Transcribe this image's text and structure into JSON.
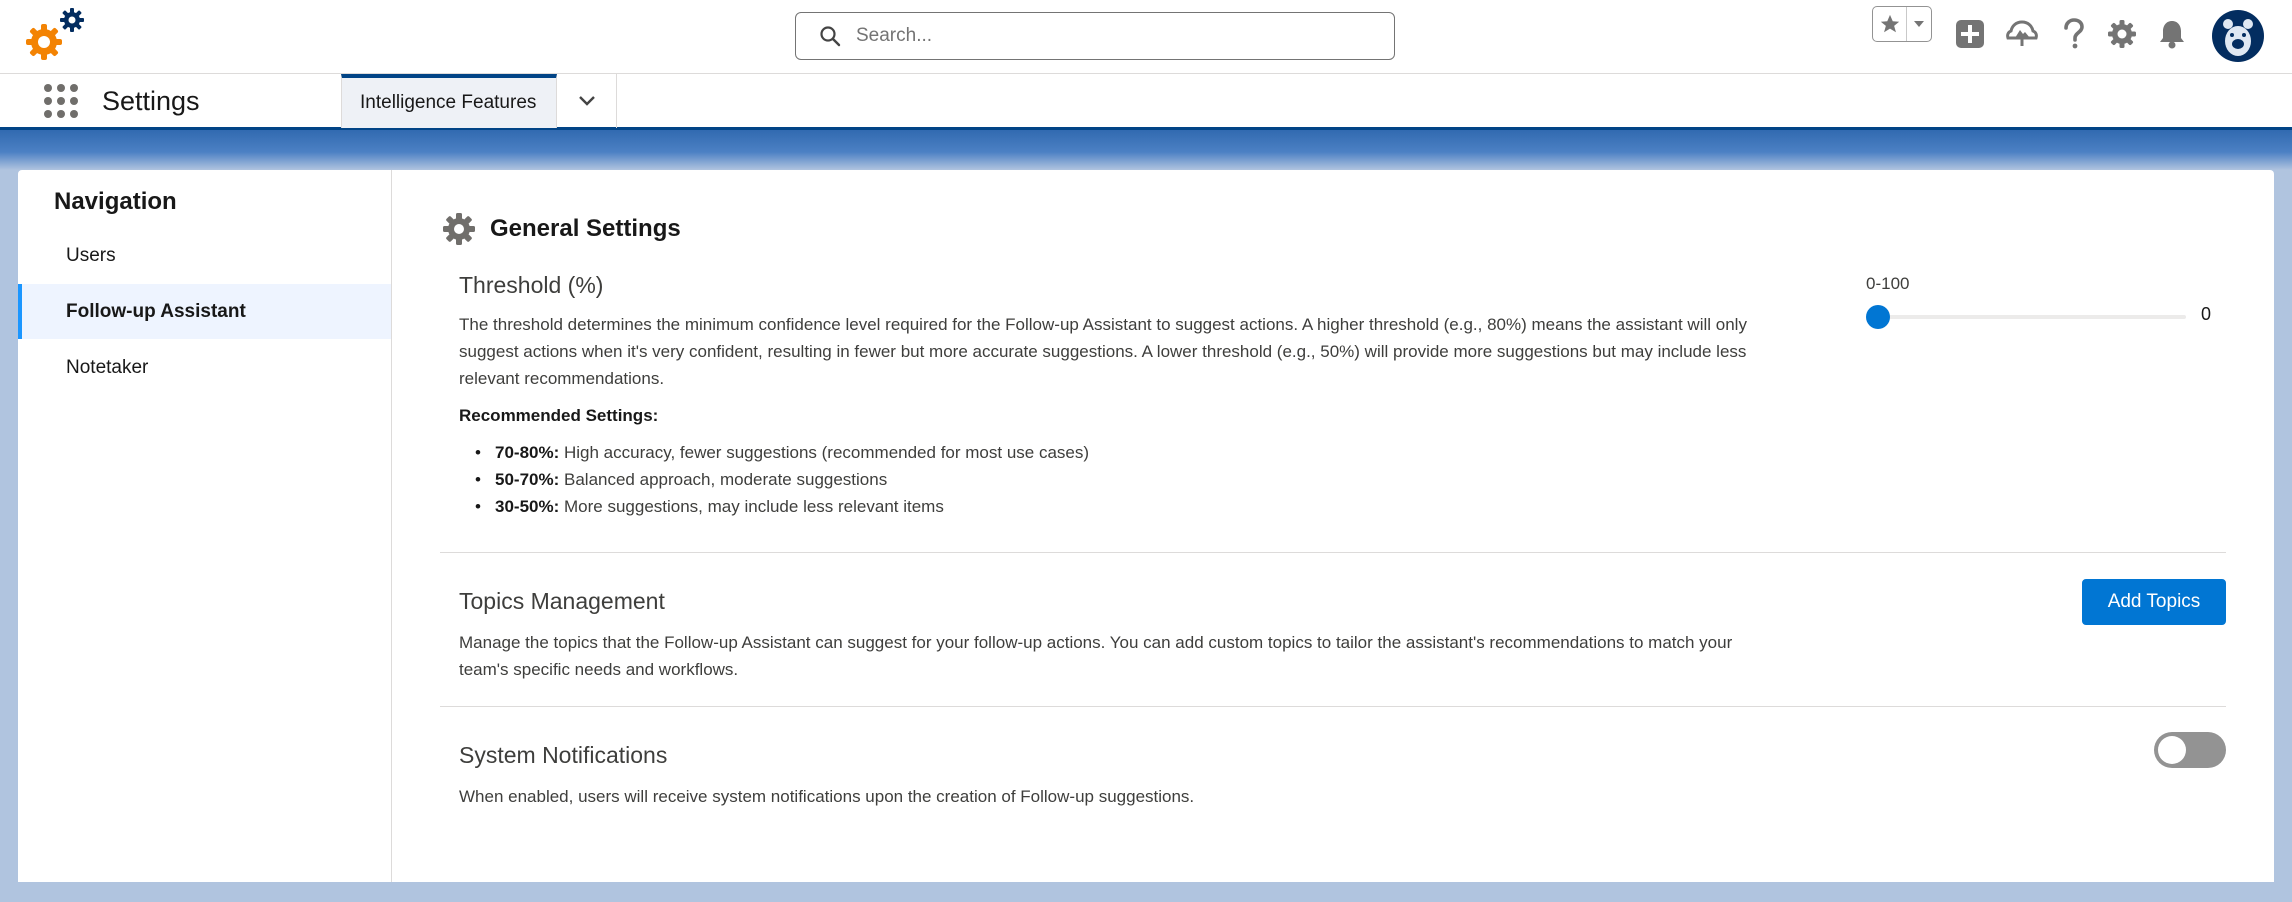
{
  "header": {
    "search_placeholder": "Search..."
  },
  "app_nav": {
    "app_name": "Settings",
    "tab_label": "Intelligence Features"
  },
  "sidebar": {
    "title": "Navigation",
    "items": [
      {
        "label": "Users",
        "active": false
      },
      {
        "label": "Follow-up Assistant",
        "active": true
      },
      {
        "label": "Notetaker",
        "active": false
      }
    ]
  },
  "main": {
    "section_title": "General Settings",
    "threshold": {
      "title": "Threshold (%)",
      "description": "The threshold determines the minimum confidence level required for the Follow-up Assistant to suggest actions. A higher threshold (e.g., 80%) means the assistant will only suggest actions when it's very confident, resulting in fewer but more accurate suggestions. A lower threshold (e.g., 50%) will provide more suggestions but may include less relevant recommendations.",
      "recommended_title": "Recommended Settings:",
      "recommendations": [
        {
          "range": "70-80%:",
          "text": "High accuracy, fewer suggestions (recommended for most use cases)"
        },
        {
          "range": "50-70%:",
          "text": "Balanced approach, moderate suggestions"
        },
        {
          "range": "30-50%:",
          "text": "More suggestions, may include less relevant items"
        }
      ],
      "slider_label": "0-100",
      "slider_value": "0",
      "slider_fraction": 0
    },
    "topics": {
      "title": "Topics Management",
      "description": "Manage the topics that the Follow-up Assistant can suggest for your follow-up actions. You can add custom topics to tailor the assistant's recommendations to match your team's specific needs and workflows.",
      "button_label": "Add Topics"
    },
    "notifications": {
      "title": "System Notifications",
      "description": "When enabled, users will receive system notifications upon the creation of Follow-up suggestions.",
      "enabled": false
    }
  },
  "colors": {
    "brand_blue": "#0176d3",
    "nav_accent": "#014486",
    "background_band": "#b0c4df"
  }
}
